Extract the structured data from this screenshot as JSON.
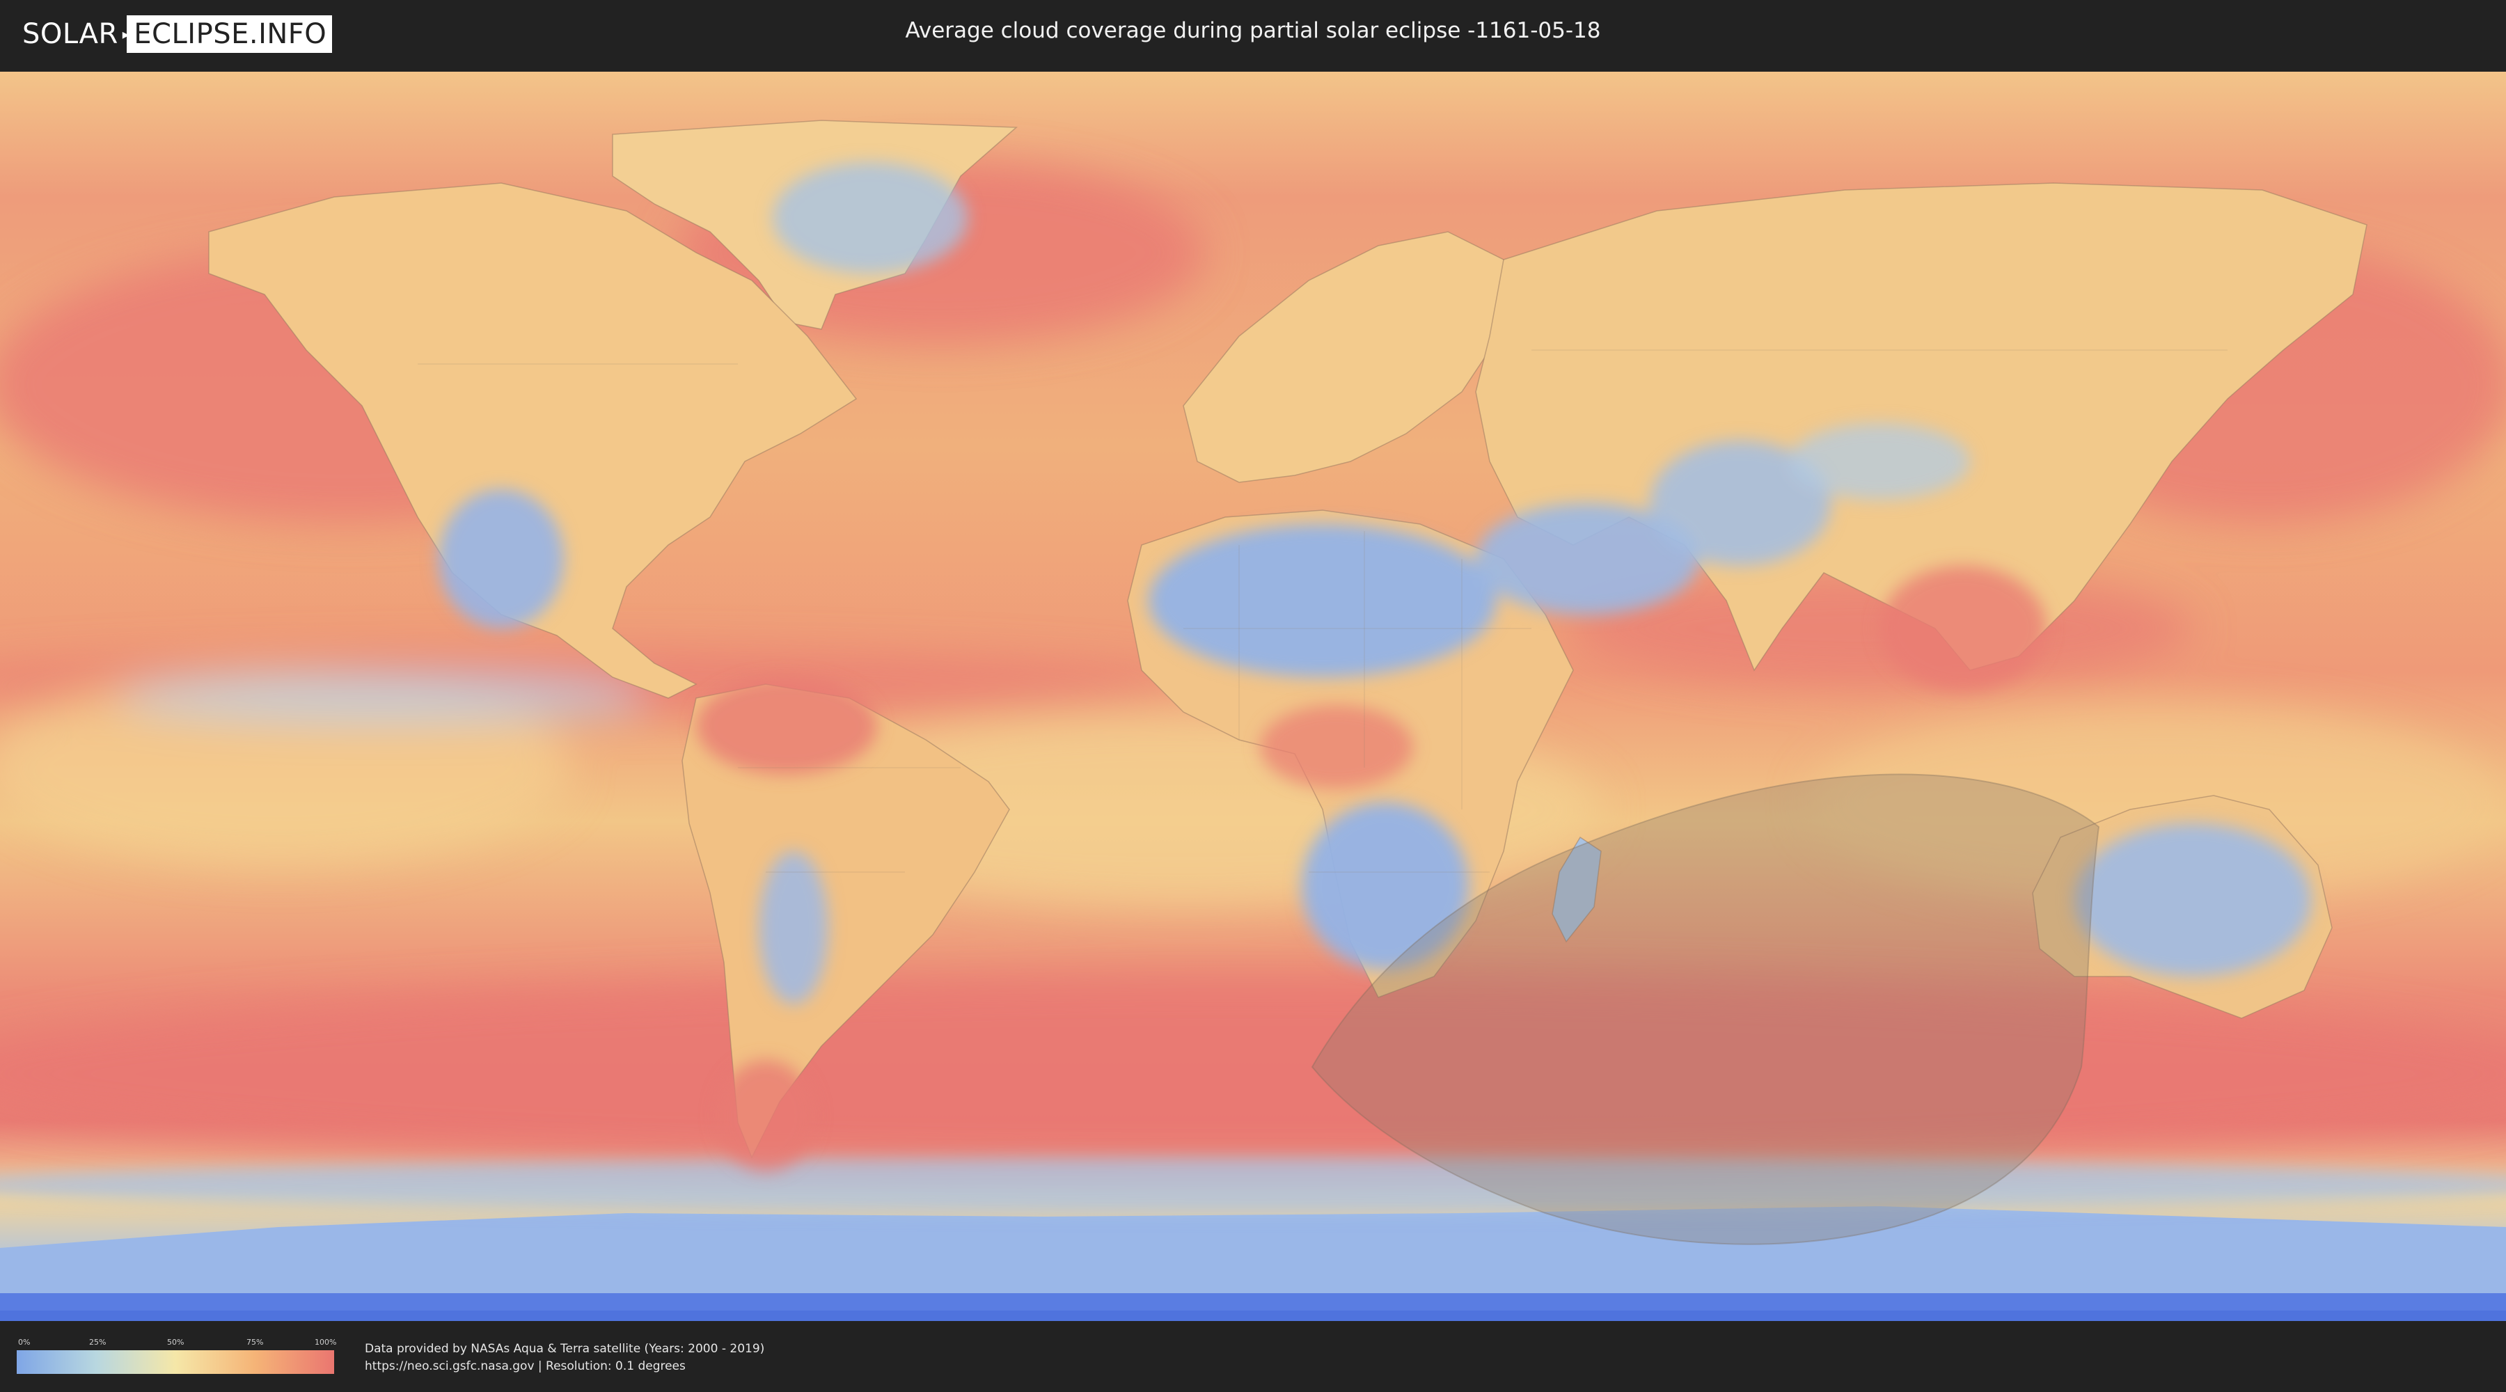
{
  "header": {
    "logo_left": "SOLAR",
    "logo_right": "ECLIPSE.INFO",
    "title": "Average cloud coverage during partial solar eclipse -1161-05-18"
  },
  "legend": {
    "ticks": [
      "0%",
      "25%",
      "50%",
      "75%",
      "100%"
    ],
    "colors": [
      "#7fa6e6",
      "#b8d7e0",
      "#f5e7a8",
      "#f5b477",
      "#ea7670"
    ]
  },
  "footer": {
    "line1": "Data provided by NASAs Aqua & Terra satellite (Years: 2000 - 2019)",
    "line2": "https://neo.sci.gsfc.nasa.gov | Resolution: 0.1 degrees"
  },
  "map": {
    "ocean_color": "#ec8f79",
    "land_cloudy_color": "#f2c486",
    "clear_color": "#9ab8e3",
    "ice_color": "#5c7fe0",
    "eclipse_shade_color": "#8a7a6a"
  }
}
